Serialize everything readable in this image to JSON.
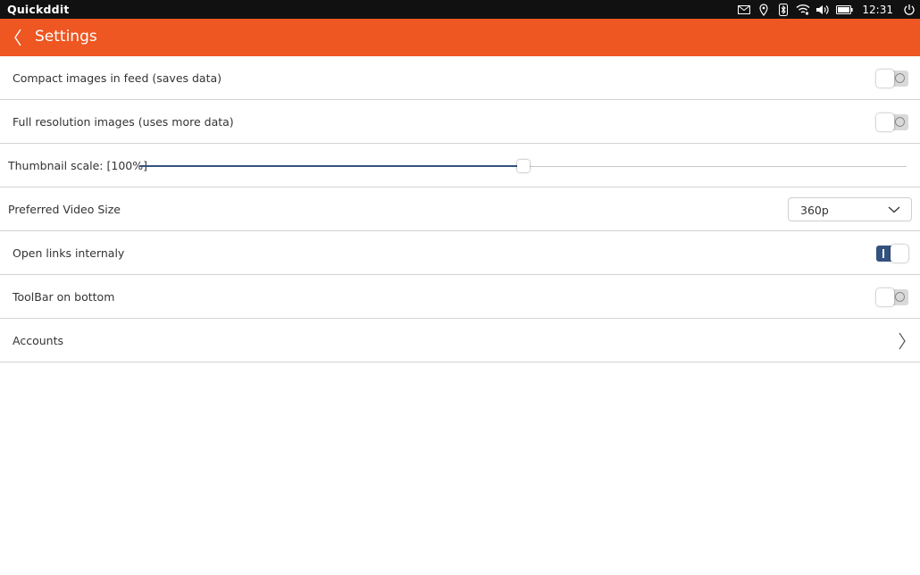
{
  "status_bar": {
    "app_name": "Quickddit",
    "time": "12:31",
    "icons": [
      "mail-icon",
      "location-icon",
      "bluetooth-icon",
      "wifi-icon",
      "volume-icon",
      "battery-icon",
      "power-icon"
    ]
  },
  "header": {
    "title": "Settings",
    "back_icon": "chevron-left-icon",
    "color": "#ee5622"
  },
  "settings": {
    "compact_images": {
      "label": "Compact images in feed (saves data)",
      "enabled": false
    },
    "full_resolution": {
      "label": "Full resolution images (uses more data)",
      "enabled": false
    },
    "thumbnail_scale": {
      "label": "Thumbnail scale: [100%]",
      "value_fraction": 0.5
    },
    "preferred_video": {
      "label": "Preferred Video Size",
      "selected": "360p"
    },
    "open_links": {
      "label": "Open links internaly",
      "enabled": true
    },
    "toolbar_bottom": {
      "label": "ToolBar on bottom",
      "enabled": false
    },
    "accounts": {
      "label": "Accounts"
    }
  },
  "colors": {
    "switch_on": "#335280",
    "switch_off": "#d9d9d9",
    "divider": "#d3d3d3"
  }
}
